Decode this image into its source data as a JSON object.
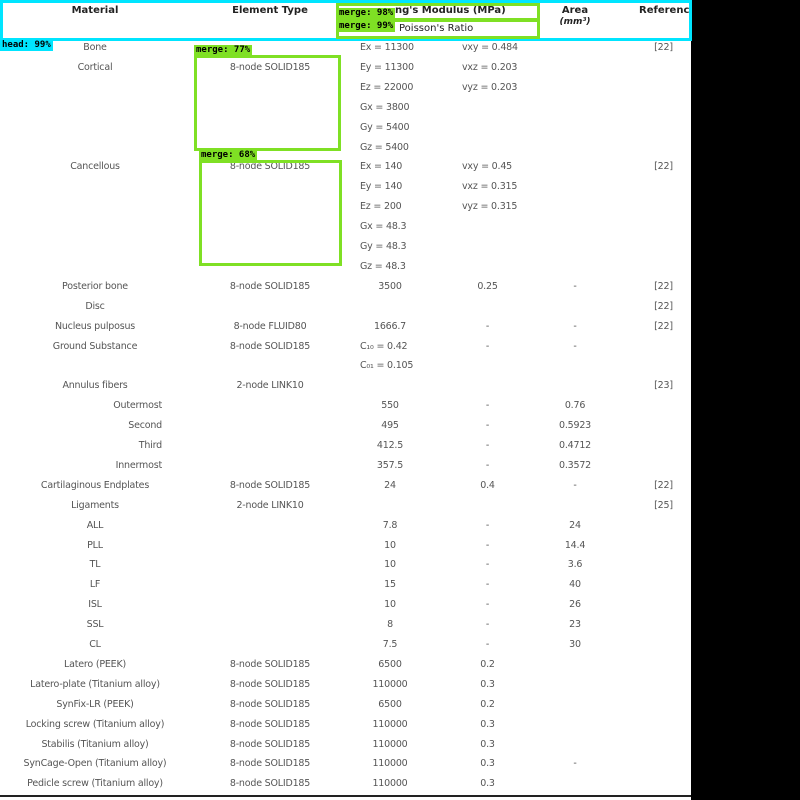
{
  "header": {
    "material": "Material",
    "element_type": "Element Type",
    "youngs_modulus": "ng's Modulus (MPa)",
    "poissons_ratio": "Poisson's Ratio",
    "area": "Area",
    "area_unit": "(mm³)",
    "reference": "Reference"
  },
  "rows": [
    {
      "material": "Bone",
      "indent": false,
      "element": "",
      "modulus": "Ex = 11300",
      "poisson": "vxy = 0.484",
      "area": "",
      "ref": "[22]"
    },
    {
      "material": "Cortical",
      "indent": false,
      "element": "8-node SOLID185",
      "modulus": "Ey = 11300",
      "poisson": "vxz = 0.203",
      "area": "",
      "ref": ""
    },
    {
      "material": "",
      "indent": false,
      "element": "",
      "modulus": "Ez = 22000",
      "poisson": "vyz = 0.203",
      "area": "",
      "ref": ""
    },
    {
      "material": "",
      "indent": false,
      "element": "",
      "modulus": "Gx = 3800",
      "poisson": "",
      "area": "",
      "ref": ""
    },
    {
      "material": "",
      "indent": false,
      "element": "",
      "modulus": "Gy = 5400",
      "poisson": "",
      "area": "",
      "ref": ""
    },
    {
      "material": "",
      "indent": false,
      "element": "",
      "modulus": "Gz = 5400",
      "poisson": "",
      "area": "",
      "ref": ""
    },
    {
      "material": "Cancellous",
      "indent": false,
      "element": "8-node SOLID185",
      "modulus": "Ex = 140",
      "poisson": "vxy = 0.45",
      "area": "",
      "ref": "[22]"
    },
    {
      "material": "",
      "indent": false,
      "element": "",
      "modulus": "Ey = 140",
      "poisson": "vxz = 0.315",
      "area": "",
      "ref": ""
    },
    {
      "material": "",
      "indent": false,
      "element": "",
      "modulus": "Ez = 200",
      "poisson": "vyz = 0.315",
      "area": "",
      "ref": ""
    },
    {
      "material": "",
      "indent": false,
      "element": "",
      "modulus": "Gx = 48.3",
      "poisson": "",
      "area": "",
      "ref": ""
    },
    {
      "material": "",
      "indent": false,
      "element": "",
      "modulus": "Gy = 48.3",
      "poisson": "",
      "area": "",
      "ref": ""
    },
    {
      "material": "",
      "indent": false,
      "element": "",
      "modulus": "Gz = 48.3",
      "poisson": "",
      "area": "",
      "ref": ""
    },
    {
      "material": "Posterior bone",
      "indent": false,
      "element": "8-node SOLID185",
      "modulus": "3500",
      "poisson": "0.25",
      "area": "-",
      "ref": "[22]"
    },
    {
      "material": "Disc",
      "indent": false,
      "element": "",
      "modulus": "",
      "poisson": "",
      "area": "",
      "ref": "[22]"
    },
    {
      "material": "Nucleus pulposus",
      "indent": false,
      "element": "8-node FLUID80",
      "modulus": "1666.7",
      "poisson": "-",
      "area": "-",
      "ref": "[22]"
    },
    {
      "material": "Ground Substance",
      "indent": false,
      "element": "8-node SOLID185",
      "modulus": "C₁₀ = 0.42",
      "poisson": "-",
      "area": "-",
      "ref": ""
    },
    {
      "material": "",
      "indent": false,
      "element": "",
      "modulus": "C₀₁ = 0.105",
      "poisson": "",
      "area": "",
      "ref": ""
    },
    {
      "material": "Annulus fibers",
      "indent": false,
      "element": "2-node LINK10",
      "modulus": "",
      "poisson": "",
      "area": "",
      "ref": "[23]"
    },
    {
      "material": "Outermost",
      "indent": true,
      "element": "",
      "modulus": "550",
      "poisson": "-",
      "area": "0.76",
      "ref": ""
    },
    {
      "material": "Second",
      "indent": true,
      "element": "",
      "modulus": "495",
      "poisson": "-",
      "area": "0.5923",
      "ref": ""
    },
    {
      "material": "Third",
      "indent": true,
      "element": "",
      "modulus": "412.5",
      "poisson": "-",
      "area": "0.4712",
      "ref": ""
    },
    {
      "material": "Innermost",
      "indent": true,
      "element": "",
      "modulus": "357.5",
      "poisson": "-",
      "area": "0.3572",
      "ref": ""
    },
    {
      "material": "Cartilaginous Endplates",
      "indent": false,
      "element": "8-node SOLID185",
      "modulus": "24",
      "poisson": "0.4",
      "area": "-",
      "ref": "[22]"
    },
    {
      "material": "Ligaments",
      "indent": false,
      "element": "2-node LINK10",
      "modulus": "",
      "poisson": "",
      "area": "",
      "ref": "[25]"
    },
    {
      "material": "ALL",
      "indent": false,
      "element": "",
      "modulus": "7.8",
      "poisson": "-",
      "area": "24",
      "ref": ""
    },
    {
      "material": "PLL",
      "indent": false,
      "element": "",
      "modulus": "10",
      "poisson": "-",
      "area": "14.4",
      "ref": ""
    },
    {
      "material": "TL",
      "indent": false,
      "element": "",
      "modulus": "10",
      "poisson": "-",
      "area": "3.6",
      "ref": ""
    },
    {
      "material": "LF",
      "indent": false,
      "element": "",
      "modulus": "15",
      "poisson": "-",
      "area": "40",
      "ref": ""
    },
    {
      "material": "ISL",
      "indent": false,
      "element": "",
      "modulus": "10",
      "poisson": "-",
      "area": "26",
      "ref": ""
    },
    {
      "material": "SSL",
      "indent": false,
      "element": "",
      "modulus": "8",
      "poisson": "-",
      "area": "23",
      "ref": ""
    },
    {
      "material": "CL",
      "indent": false,
      "element": "",
      "modulus": "7.5",
      "poisson": "-",
      "area": "30",
      "ref": ""
    },
    {
      "material": "Latero (PEEK)",
      "indent": false,
      "element": "8-node SOLID185",
      "modulus": "6500",
      "poisson": "0.2",
      "area": "",
      "ref": ""
    },
    {
      "material": "Latero-plate (Titanium alloy)",
      "indent": false,
      "element": "8-node SOLID185",
      "modulus": "110000",
      "poisson": "0.3",
      "area": "",
      "ref": ""
    },
    {
      "material": "SynFix-LR (PEEK)",
      "indent": false,
      "element": "8-node SOLID185",
      "modulus": "6500",
      "poisson": "0.2",
      "area": "",
      "ref": ""
    },
    {
      "material": "Locking screw (Titanium alloy)",
      "indent": false,
      "element": "8-node SOLID185",
      "modulus": "110000",
      "poisson": "0.3",
      "area": "",
      "ref": ""
    },
    {
      "material": "Stabilis (Titanium alloy)",
      "indent": false,
      "element": "8-node SOLID185",
      "modulus": "110000",
      "poisson": "0.3",
      "area": "",
      "ref": ""
    },
    {
      "material": "SynCage-Open (Titanium alloy)",
      "indent": false,
      "element": "8-node SOLID185",
      "modulus": "110000",
      "poisson": "0.3",
      "area": "-",
      "ref": ""
    },
    {
      "material": "Pedicle screw (Titanium alloy)",
      "indent": false,
      "element": "8-node SOLID185",
      "modulus": "110000",
      "poisson": "0.3",
      "area": "",
      "ref": ""
    }
  ],
  "overlays": [
    {
      "kind": "head",
      "label": "head: 99%"
    },
    {
      "kind": "merge",
      "label": "merge: 98%"
    },
    {
      "kind": "merge",
      "label": "merge: 99%"
    },
    {
      "kind": "merge",
      "label": "merge: 77%"
    },
    {
      "kind": "merge",
      "label": "merge: 68%"
    }
  ],
  "colors": {
    "head_box": "#00e5ff",
    "merge_box": "#7fe024",
    "text": "#555555",
    "header_text": "#222222"
  }
}
